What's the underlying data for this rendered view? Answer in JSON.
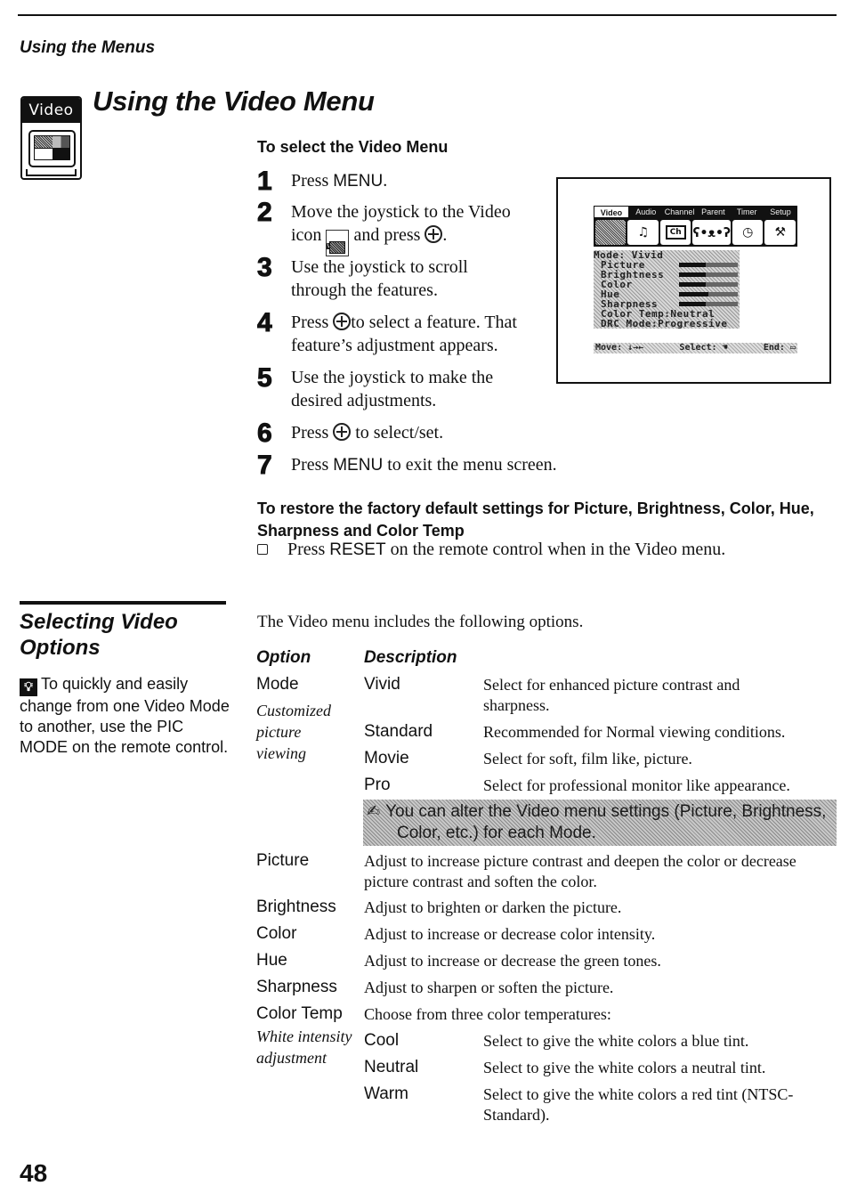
{
  "header": {
    "running_head": "Using the Menus",
    "badge_label": "Video",
    "page_title": "Using the Video Menu"
  },
  "select_section": {
    "heading": "To select the Video Menu",
    "steps": [
      {
        "num": "1",
        "text": "Press ",
        "key": "MENU",
        "after": "."
      },
      {
        "num": "2",
        "line1": "Move the joystick to the Video",
        "line2_a": "icon",
        "line2_b": "and press",
        "icon_label": "Video"
      },
      {
        "num": "3",
        "line1": "Use the joystick to scroll",
        "line2": "through the features."
      },
      {
        "num": "4",
        "line1_a": "Press",
        "line1_b": "to select a feature. That",
        "line2": "feature’s adjustment appears."
      },
      {
        "num": "5",
        "line1": "Use the joystick to make the",
        "line2": "desired adjustments."
      },
      {
        "num": "6",
        "a": "Press",
        "b": "to select/set."
      },
      {
        "num": "7",
        "a": "Press ",
        "key": "MENU",
        "b": " to exit the menu screen."
      }
    ]
  },
  "osd": {
    "tabs": [
      "Video",
      "Audio",
      "Channel",
      "Parent",
      "Timer",
      "Setup"
    ],
    "active_tab": "Video",
    "icons": [
      "tv-icon",
      "audio-icon",
      "channel-icon",
      "parent-icon",
      "timer-icon",
      "setup-icon"
    ],
    "channel_icon_text": "Ch",
    "mode_line": "Mode: Vivid",
    "rows": [
      {
        "label": "Picture",
        "level": 0.45
      },
      {
        "label": "Brightness",
        "level": 0.45
      },
      {
        "label": "Color",
        "level": 0.45
      },
      {
        "label": "Hue",
        "level": 0.5
      },
      {
        "label": "Sharpness",
        "level": 0.45
      }
    ],
    "color_temp_line": "Color Temp:Neutral",
    "drc_line": "DRC Mode:Progressive",
    "footer": {
      "move": "Move: ↓→←",
      "select": "Select:",
      "end": "End:"
    }
  },
  "restore_section": {
    "heading": "To restore the factory default settings for Picture, Brightness, Color, Hue, Sharpness and Color Temp",
    "item_a": "Press ",
    "item_key": "RESET",
    "item_b": " on the remote control when in the Video menu."
  },
  "options_section": {
    "title": "Selecting Video Options",
    "tip": "To quickly and easily change from one Video Mode to another, use the PIC MODE on the remote control.",
    "intro": "The Video menu includes the following options.",
    "col_option": "Option",
    "col_description": "Description",
    "mode": {
      "label": "Mode",
      "note": "Customized picture viewing",
      "subs": [
        {
          "name": "Vivid",
          "desc": "Select for enhanced picture contrast and sharpness."
        },
        {
          "name": "Standard",
          "desc": "Recommended for Normal viewing conditions."
        },
        {
          "name": "Movie",
          "desc": "Select for soft, film like, picture."
        },
        {
          "name": "Pro",
          "desc": "Select for professional monitor like appearance."
        }
      ]
    },
    "note_line1": "You can alter the Video menu settings (Picture, Brightness,",
    "note_line2": "Color, etc.) for each Mode.",
    "options": [
      {
        "name": "Picture",
        "desc": "Adjust to increase picture contrast and deepen the color or decrease picture contrast and soften the color."
      },
      {
        "name": "Brightness",
        "desc": "Adjust to brighten or darken the picture."
      },
      {
        "name": "Color",
        "desc": "Adjust to increase or decrease color intensity."
      },
      {
        "name": "Hue",
        "desc": "Adjust to increase or decrease the green tones."
      },
      {
        "name": "Sharpness",
        "desc": "Adjust to sharpen or soften the picture."
      }
    ],
    "color_temp": {
      "label": "Color Temp",
      "desc": "Choose from three color temperatures:",
      "note": "White intensity adjustment",
      "subs": [
        {
          "name": "Cool",
          "desc": "Select to give the white colors a blue tint."
        },
        {
          "name": "Neutral",
          "desc": "Select to give the white colors a neutral tint."
        },
        {
          "name": "Warm",
          "desc": "Select to give the white colors a red tint (NTSC-Standard)."
        }
      ]
    }
  },
  "footer": {
    "page_number": "48"
  }
}
